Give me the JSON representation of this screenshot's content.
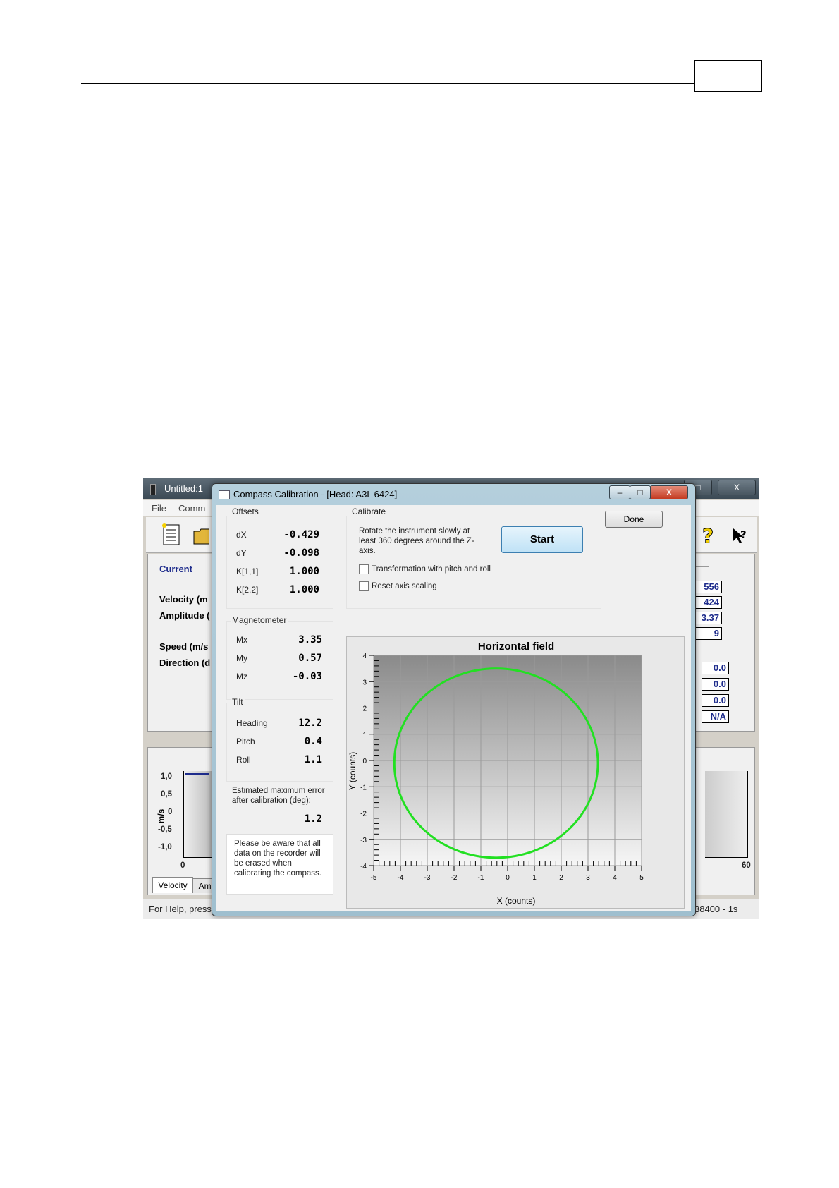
{
  "main_window": {
    "title": "Untitled:1",
    "min": "–",
    "max": "□",
    "close": "X",
    "menu": [
      "File",
      "Comm"
    ],
    "labels": {
      "current": "Current",
      "velocity": "Velocity (m",
      "amplitude": "Amplitude (",
      "speed": "Speed (m/s",
      "direction": "Direction (d"
    },
    "values_right": [
      "556",
      "424",
      "3.37",
      "9",
      "0.0",
      "0.0",
      "0.0",
      "N/A"
    ],
    "lower_chart": {
      "ylabel": "m/s",
      "yticks": [
        "1,0",
        "0,5",
        "0",
        "-0,5",
        "-1,0"
      ],
      "x_left": "0",
      "x_right": "60"
    },
    "tabs": [
      "Velocity",
      "Amp"
    ],
    "status_left": "For Help, press",
    "status_right": "38400 - 1s"
  },
  "dialog": {
    "title": "Compass Calibration - [Head: A3L 6424]",
    "offsets": {
      "title": "Offsets",
      "rows": [
        {
          "label": "dX",
          "value": "-0.429"
        },
        {
          "label": "dY",
          "value": "-0.098"
        },
        {
          "label": "K[1,1]",
          "value": "1.000"
        },
        {
          "label": "K[2,2]",
          "value": "1.000"
        }
      ]
    },
    "magnetometer": {
      "title": "Magnetometer",
      "rows": [
        {
          "label": "Mx",
          "value": "3.35"
        },
        {
          "label": "My",
          "value": "0.57"
        },
        {
          "label": "Mz",
          "value": "-0.03"
        }
      ]
    },
    "tilt": {
      "title": "Tilt",
      "rows": [
        {
          "label": "Heading",
          "value": "12.2"
        },
        {
          "label": "Pitch",
          "value": "0.4"
        },
        {
          "label": "Roll",
          "value": "1.1"
        }
      ]
    },
    "error_label": "Estimated maximum error after calibration (deg):",
    "error_value": "1.2",
    "warning": "Please be aware that all data on the recorder will be erased when calibrating the compass.",
    "calibrate": {
      "title": "Calibrate",
      "instructions": "Rotate the instrument slowly at least 360 degrees around the Z-axis.",
      "start": "Start",
      "option1": "Transformation with pitch and roll",
      "option2": "Reset axis scaling"
    },
    "done": "Done",
    "colors": {
      "curve": "#22e022",
      "accent": "#3c7fb1"
    }
  },
  "chart_data": {
    "type": "scatter",
    "title": "Horizontal field",
    "xlabel": "X (counts)",
    "ylabel": "Y (counts)",
    "xlim": [
      -5,
      5
    ],
    "ylim": [
      -4,
      4
    ],
    "xticks": [
      -5,
      -4,
      -3,
      -2,
      -1,
      0,
      1,
      2,
      3,
      4,
      5
    ],
    "yticks": [
      4,
      3,
      2,
      1,
      0,
      -1,
      -2,
      -3,
      -4
    ],
    "grid": true,
    "series": [
      {
        "shape": "ellipse",
        "center": [
          -0.43,
          -0.1
        ],
        "radius_x": 3.8,
        "radius_y": 3.6,
        "color": "#22e022"
      }
    ]
  }
}
